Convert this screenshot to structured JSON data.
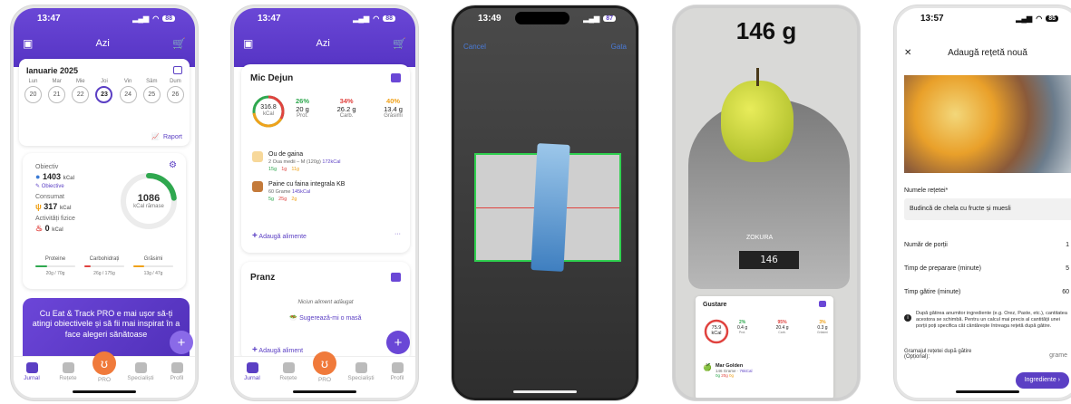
{
  "colors": {
    "primary": "#5b3fc4",
    "accent": "#f07a3b",
    "protein": "#2fa84f",
    "carbs": "#e0433f",
    "fat": "#f0a21b"
  },
  "screen1": {
    "time": "13:47",
    "battery": "88",
    "title": "Azi",
    "month": "Ianuarie 2025",
    "days": [
      {
        "name": "Lun",
        "num": "20"
      },
      {
        "name": "Mar",
        "num": "21"
      },
      {
        "name": "Mie",
        "num": "22"
      },
      {
        "name": "Joi",
        "num": "23"
      },
      {
        "name": "Vin",
        "num": "24"
      },
      {
        "name": "Sâm",
        "num": "25"
      },
      {
        "name": "Dum",
        "num": "26"
      }
    ],
    "report": "Raport",
    "goal_label": "Obiectiv",
    "goal_value": "1403",
    "unit": "kCal",
    "goal_link": "Obiective",
    "consumed_label": "Consumat",
    "consumed_value": "317",
    "activity_label": "Activități fizice",
    "activity_value": "0",
    "remaining_value": "1086",
    "remaining_label": "kCal rămase",
    "remaining_fraction": 0.23,
    "macros": [
      {
        "name": "Proteine",
        "value": "20g / 70g",
        "fraction": 0.29
      },
      {
        "name": "Carbohidrați",
        "value": "26g / 175g",
        "fraction": 0.15
      },
      {
        "name": "Grăsimi",
        "value": "13g / 47g",
        "fraction": 0.28
      }
    ],
    "promo": "Cu Eat & Track PRO e mai ușor să-ți atingi obiectivele și să fii mai inspirat în a face alegeri sănătoase",
    "tabs": [
      "Jurnal",
      "Rețete",
      "PRO",
      "Specialiști",
      "Profil"
    ]
  },
  "screen2": {
    "time": "13:47",
    "battery": "88",
    "title": "Azi",
    "meal": "Mic Dejun",
    "kcal": "316.8",
    "kcal_unit": "kCal",
    "macros": [
      {
        "pct": "26%",
        "grams": "20 g",
        "name": "Prot."
      },
      {
        "pct": "34%",
        "grams": "26.2 g",
        "name": "Carb."
      },
      {
        "pct": "40%",
        "grams": "13.4 g",
        "name": "Grăsimi"
      }
    ],
    "foods": [
      {
        "name": "Ou de gaina",
        "qty": "2 Oua medii – M (120g)",
        "kcal": "172kCal",
        "p": "15g",
        "c": "1g",
        "f": "11g"
      },
      {
        "name": "Paine cu faina integrala KB",
        "qty": "60 Grame",
        "kcal": "145kCal",
        "p": "5g",
        "c": "25g",
        "f": "2g"
      }
    ],
    "add": "Adaugă alimente",
    "more": "···",
    "meal2": "Pranz",
    "empty": "Niciun aliment adăugat",
    "suggest": "Sugerează-mi o masă",
    "add2": "Adaugă aliment",
    "tabs": [
      "Jurnal",
      "Rețete",
      "PRO",
      "Specialiști",
      "Profil"
    ]
  },
  "screen3": {
    "time": "13:49",
    "battery": "87",
    "cancel": "Cancel",
    "done": "Gata"
  },
  "screen4": {
    "weight": "146 g",
    "brand": "ZOKURA",
    "display": "146",
    "meal": "Gustare",
    "kcal": "75.9",
    "kcal_unit": "kCal",
    "macros": [
      {
        "pct": "2%",
        "grams": "0.4 g",
        "name": "Prot."
      },
      {
        "pct": "95%",
        "grams": "20.4 g",
        "name": "Carb."
      },
      {
        "pct": "3%",
        "grams": "0.3 g",
        "name": "Grăsimi"
      }
    ],
    "food": {
      "name": "Mar Golden",
      "qty": "146 Grame",
      "kcal": "76kCal",
      "p": "0g",
      "c": "20g",
      "f": "0g"
    }
  },
  "screen5": {
    "time": "13:57",
    "battery": "85",
    "title": "Adaugă rețetă nouă",
    "name_label": "Numele rețetei*",
    "name_value": "Budincă de chela cu fructe și muesli",
    "fields": [
      {
        "label": "Număr de porții",
        "value": "1"
      },
      {
        "label": "Timp de preparare (minute)",
        "value": "5"
      },
      {
        "label": "Timp gătire (minute)",
        "value": "60"
      }
    ],
    "info": "După gătirea anumitor ingrediente (e.g. Orez, Paste, etc.), cantitatea acestora se schimbă. Pentru un calcul mai precis al cantității unei porții poți specifica cât cântărește întreaga rețetă după gătire.",
    "weight_label": "Gramajul rețetei după gătire (Opțional):",
    "weight_unit": "grame",
    "next": "Ingrediente"
  }
}
